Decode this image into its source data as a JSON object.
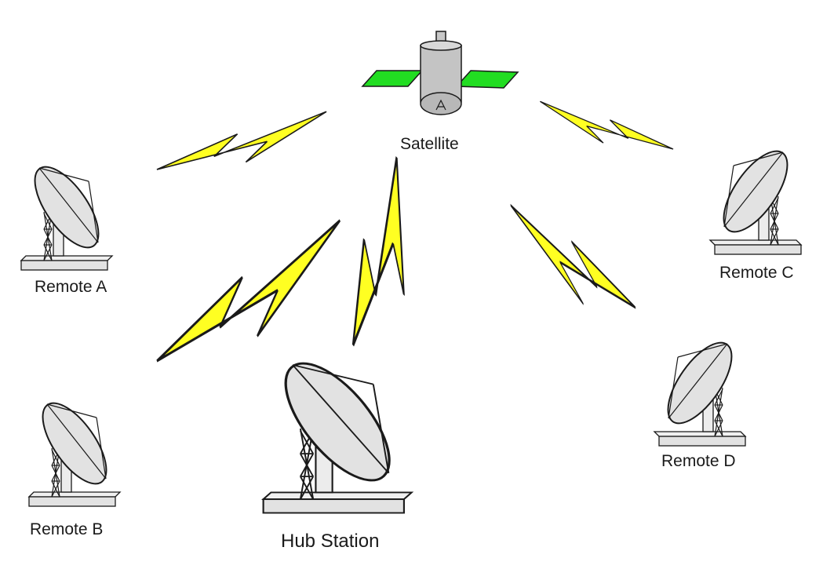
{
  "labels": {
    "satellite": "Satellite",
    "remote_a": "Remote A",
    "remote_b": "Remote B",
    "remote_c": "Remote C",
    "remote_d": "Remote D",
    "hub": "Hub Station"
  },
  "colors": {
    "solar_panel": "#22dd22",
    "bolt": "#ffff22",
    "dish": "#e2e2e2",
    "outline": "#1a1a1a"
  }
}
